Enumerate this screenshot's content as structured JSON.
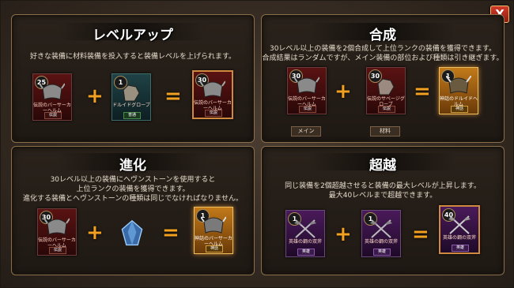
{
  "window": {
    "close_label": "X"
  },
  "panels": {
    "levelup": {
      "title": "レベルアップ",
      "desc": [
        "好きな装備に材料装備を投入すると装備レベルを上げられます。"
      ],
      "cards": [
        {
          "level": "25",
          "name": "伝説のバーサーカーヘルム",
          "tag": "伝説",
          "style": "red"
        },
        {
          "level": "1",
          "name": "ドルイドグローブ",
          "tag": "普通",
          "style": "teal"
        },
        {
          "level": "30",
          "name": "伝説のバーサーカーヘルム",
          "tag": "伝説",
          "style": "red"
        }
      ],
      "ops": [
        "+",
        "="
      ]
    },
    "synth": {
      "title": "合成",
      "desc": [
        "30レベル以上の装備を2個合成して上位ランクの装備を獲得できます。",
        "合成結果はランダムですが、メイン装備の部位および種類は引き継ぎます。"
      ],
      "cards": [
        {
          "level": "30",
          "name": "伝説のバーサーカーヘルム",
          "tag": "伝説",
          "style": "red"
        },
        {
          "level": "30",
          "name": "伝説のサベージグローブ",
          "tag": "伝説",
          "style": "red"
        },
        {
          "level": "1",
          "name": "神話のドルイドヘルム",
          "tag": "神話",
          "style": "gold"
        }
      ],
      "labels": [
        "メイン",
        "材料"
      ],
      "ops": [
        "+",
        "="
      ]
    },
    "evolve": {
      "title": "進化",
      "desc": [
        "30レベル以上の装備にヘヴンストーンを使用すると",
        "上位ランクの装備を獲得できます。",
        "進化する装備とヘヴンストーンの種類は同じでなければなりません。"
      ],
      "cards": [
        {
          "level": "30",
          "name": "伝説のバーサーカーヘルム",
          "tag": "伝説",
          "style": "red"
        },
        {
          "level": "1",
          "name": "神話のバーサーカーヘルム",
          "tag": "神話",
          "style": "gold"
        }
      ],
      "ops": [
        "+",
        "="
      ]
    },
    "transcend": {
      "title": "超越",
      "desc": [
        "同じ装備を2個超越させると装備の最大レベルが上昇します。",
        "最大40レベルまで超越できます。"
      ],
      "cards": [
        {
          "level": "1",
          "name": "英雄の鋼の双斧",
          "tag": "英雄",
          "style": "purple"
        },
        {
          "level": "1",
          "name": "英雄の鋼の双斧",
          "tag": "英雄",
          "style": "purple"
        },
        {
          "level": "40",
          "name": "英雄の鋼の双斧",
          "tag": "英雄",
          "style": "purple"
        }
      ],
      "ops": [
        "+",
        "="
      ]
    }
  }
}
